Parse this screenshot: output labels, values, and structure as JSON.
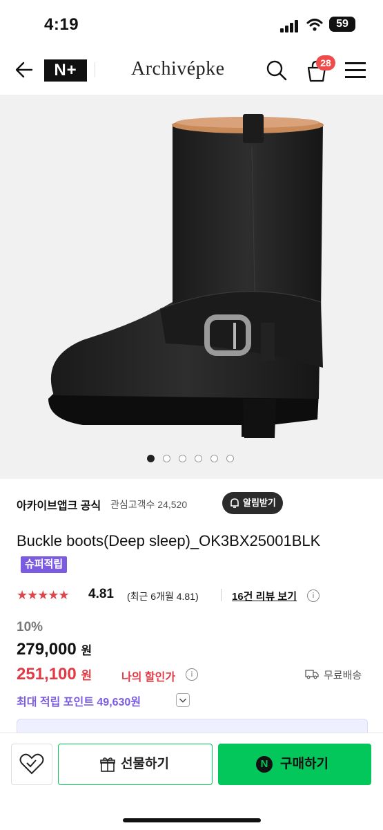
{
  "status_bar": {
    "time": "4:19",
    "battery": "59"
  },
  "header": {
    "naver_plus": "N+",
    "brand": "Archivépke",
    "cart_count": "28"
  },
  "hero": {
    "slide_count": 6,
    "active_slide": 1
  },
  "store": {
    "name": "아카이브앱크 공식",
    "interest_label": "관심고객수 24,520",
    "notify_label": "알림받기"
  },
  "product": {
    "title": "Buckle boots(Deep sleep)_OK3BX25001BLK",
    "super_badge": "슈퍼적립",
    "stars": "★★★★★",
    "rating": "4.81",
    "recent_rating": "(최근 6개월 4.81)",
    "reviews": "16건 리뷰 보기"
  },
  "price": {
    "discount": "10%",
    "original": "279,000",
    "sale": "251,100",
    "currency": "원",
    "my_discount": "나의 할인가",
    "shipping": "무료배송",
    "points_label": "최대 적립 포인트",
    "points_value": "49,630원"
  },
  "actions": {
    "gift": "선물하기",
    "buy": "구매하기",
    "buy_logo": "N"
  },
  "colors": {
    "accent_green": "#03c75a",
    "sale_red": "#e23a45",
    "points_purple": "#7b5ce0"
  }
}
